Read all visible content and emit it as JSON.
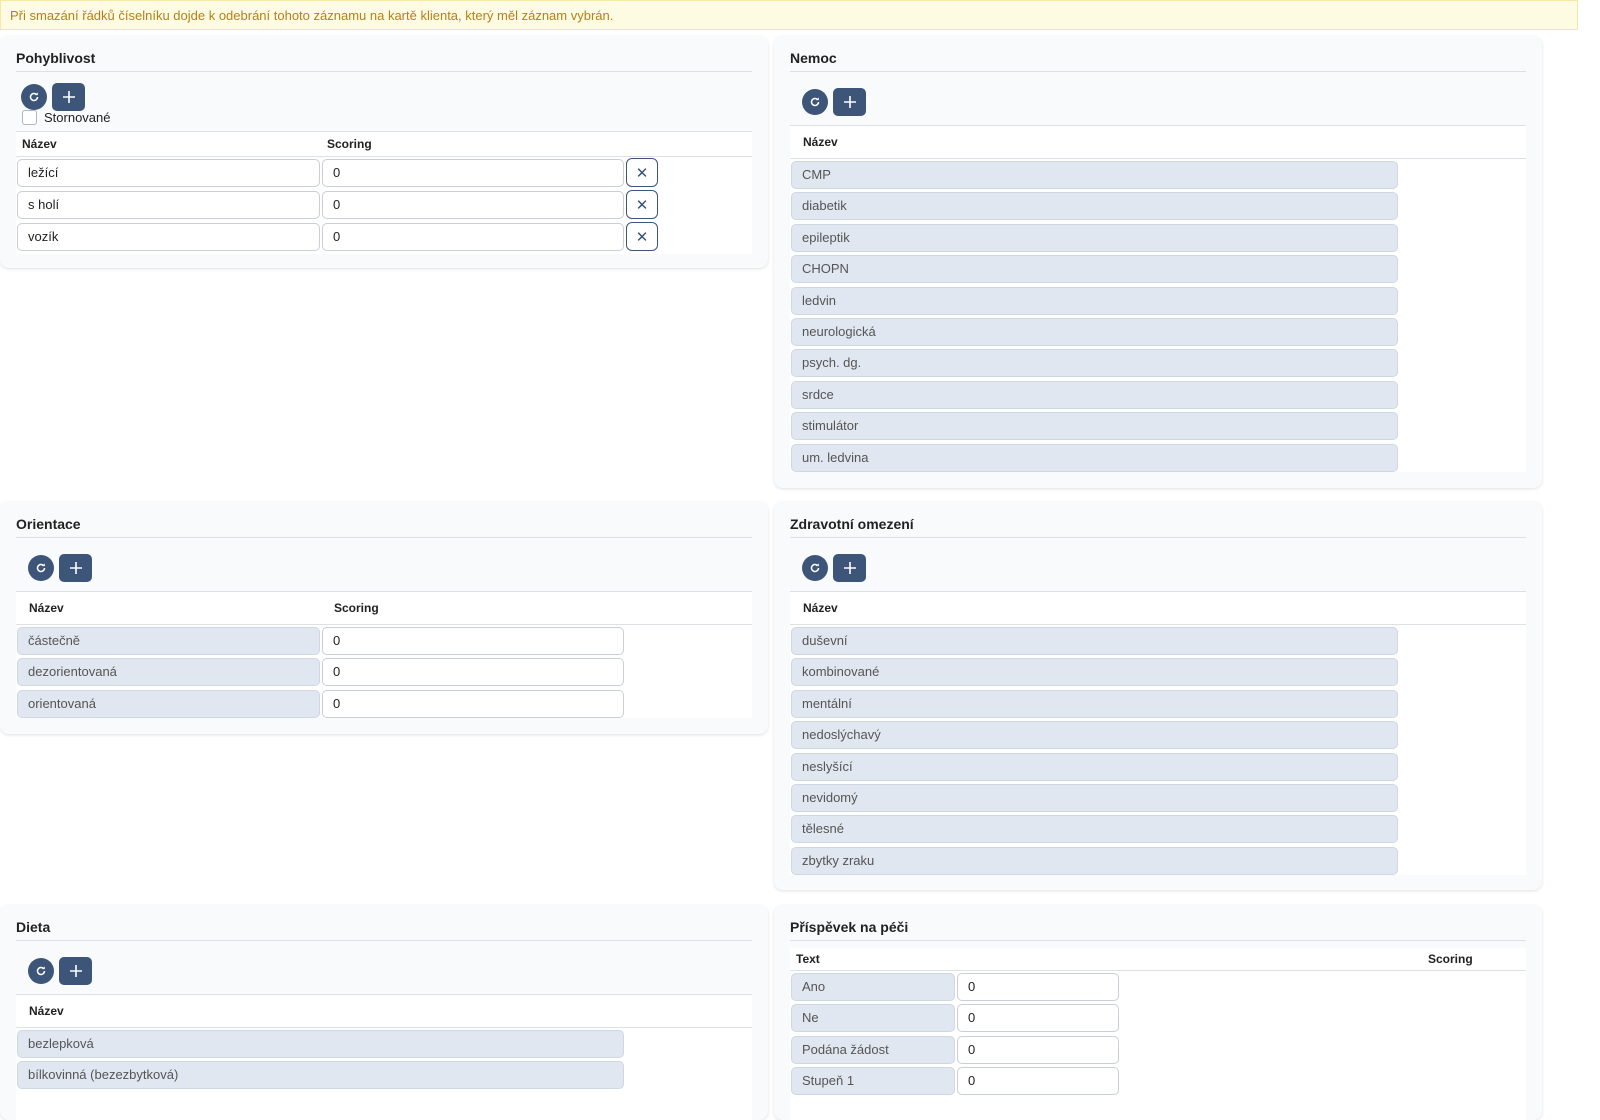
{
  "warning": "Při smazání řádků číselníku dojde k odebrání tohoto záznamu na kartě klienta, který měl záznam vybrán.",
  "icons": {
    "refresh": "refresh-icon",
    "add": "plus-icon",
    "remove": "close-icon"
  },
  "colors": {
    "primary": "#3d5579",
    "warning_bg": "#fefbe3",
    "warning_text": "#b5801a",
    "readonly_field": "#e1e7f0"
  },
  "pohyblivost": {
    "title": "Pohyblivost",
    "stornovane_label": "Stornované",
    "columns": [
      "Název",
      "Scoring"
    ],
    "rows": [
      {
        "name": "ležící",
        "scoring": "0"
      },
      {
        "name": "s holí",
        "scoring": "0"
      },
      {
        "name": "vozík",
        "scoring": "0"
      }
    ]
  },
  "nemoc": {
    "title": "Nemoc",
    "columns": [
      "Název"
    ],
    "rows": [
      "CMP",
      "diabetik",
      "epileptik",
      "CHOPN",
      "ledvin",
      "neurologická",
      "psych. dg.",
      "srdce",
      "stimulátor",
      "um. ledvina"
    ]
  },
  "orientace": {
    "title": "Orientace",
    "columns": [
      "Název",
      "Scoring"
    ],
    "rows": [
      {
        "name": "částečně",
        "scoring": "0"
      },
      {
        "name": "dezorientovaná",
        "scoring": "0"
      },
      {
        "name": "orientovaná",
        "scoring": "0"
      }
    ]
  },
  "zdravotni": {
    "title": "Zdravotní omezení",
    "columns": [
      "Název"
    ],
    "rows": [
      "duševní",
      "kombinované",
      "mentální",
      "nedoslýchavý",
      "neslyšící",
      "nevidomý",
      "tělesné",
      "zbytky zraku"
    ]
  },
  "dieta": {
    "title": "Dieta",
    "columns": [
      "Název"
    ],
    "rows": [
      "bezlepková",
      "bílkovinná (bezezbytková)"
    ]
  },
  "prispevek": {
    "title": "Příspěvek na péči",
    "columns": [
      "Text",
      "Scoring"
    ],
    "rows": [
      {
        "name": "Ano",
        "scoring": "0"
      },
      {
        "name": "Ne",
        "scoring": "0"
      },
      {
        "name": "Podána žádost",
        "scoring": "0"
      },
      {
        "name": "Stupeň 1",
        "scoring": "0"
      }
    ]
  }
}
